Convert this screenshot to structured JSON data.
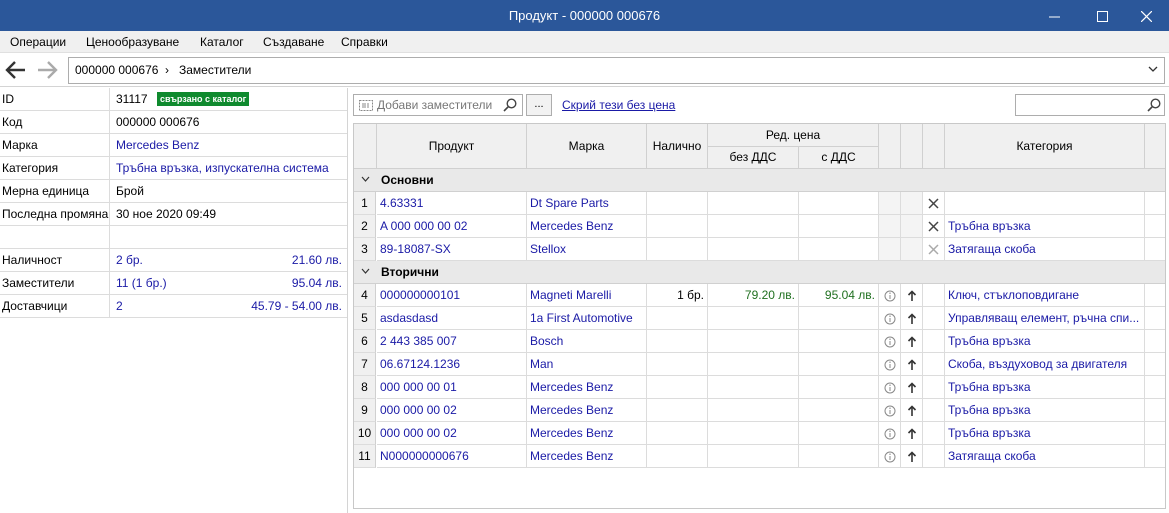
{
  "window": {
    "title": "Продукт - 000000 000676"
  },
  "menu": [
    "Операции",
    "Ценообразуване",
    "Каталог",
    "Създаване",
    "Справки"
  ],
  "breadcrumb": {
    "product": "000000 000676",
    "section": "Заместители"
  },
  "props": {
    "id": {
      "label": "ID",
      "value": "31117",
      "badge": "свързано с каталог"
    },
    "code": {
      "label": "Код",
      "value": "000000 000676"
    },
    "brand": {
      "label": "Марка",
      "value": "Mercedes Benz"
    },
    "category": {
      "label": "Категория",
      "value": "Тръбна връзка, изпускателна система"
    },
    "unit": {
      "label": "Мерна единица",
      "value": "Брой"
    },
    "modified": {
      "label": "Последна промяна",
      "value": "30 ное 2020 09:49"
    },
    "stock": {
      "label": "Наличност",
      "value": "2 бр.",
      "right": "21.60 лв."
    },
    "substitutes": {
      "label": "Заместители",
      "value": "11 (1 бр.)",
      "right": "95.04 лв."
    },
    "suppliers": {
      "label": "Доставчици",
      "value": "2",
      "right": "45.79 - 54.00 лв."
    }
  },
  "toolbar": {
    "add_placeholder": "Добави заместители",
    "dots": "...",
    "hide_link": "Скрий тези без цена"
  },
  "grid": {
    "headers": {
      "product": "Продукт",
      "brand": "Марка",
      "stock": "Налично",
      "price_group": "Ред. цена",
      "no_vat": "без ДДС",
      "with_vat": "с ДДС",
      "category": "Категория"
    },
    "groups": {
      "primary": "Основни",
      "secondary": "Вторични"
    },
    "rows": [
      {
        "n": "1",
        "product": "4.63331",
        "brand": "Dt Spare Parts",
        "stock": "",
        "no_vat": "",
        "with_vat": "",
        "category": ""
      },
      {
        "n": "2",
        "product": "A 000 000 00 02",
        "brand": "Mercedes Benz",
        "stock": "",
        "no_vat": "",
        "with_vat": "",
        "category": "Тръбна връзка"
      },
      {
        "n": "3",
        "product": "89-18087-SX",
        "brand": "Stellox",
        "stock": "",
        "no_vat": "",
        "with_vat": "",
        "category": "Затягаща скоба"
      },
      {
        "n": "4",
        "product": "000000000101",
        "brand": "Magneti Marelli",
        "stock": "1 бр.",
        "no_vat": "79.20 лв.",
        "with_vat": "95.04 лв.",
        "category": "Ключ, стъклоповдигане"
      },
      {
        "n": "5",
        "product": "asdasdasd",
        "brand": "1a First Automotive",
        "stock": "",
        "no_vat": "",
        "with_vat": "",
        "category": "Управляващ елемент, ръчна спи..."
      },
      {
        "n": "6",
        "product": "2 443 385 007",
        "brand": "Bosch",
        "stock": "",
        "no_vat": "",
        "with_vat": "",
        "category": "Тръбна връзка"
      },
      {
        "n": "7",
        "product": "06.67124.1236",
        "brand": "Man",
        "stock": "",
        "no_vat": "",
        "with_vat": "",
        "category": "Скоба, въздуховод за двигателя"
      },
      {
        "n": "8",
        "product": "000 000 00 01",
        "brand": "Mercedes Benz",
        "stock": "",
        "no_vat": "",
        "with_vat": "",
        "category": "Тръбна връзка"
      },
      {
        "n": "9",
        "product": "000 000 00 02",
        "brand": "Mercedes Benz",
        "stock": "",
        "no_vat": "",
        "with_vat": "",
        "category": "Тръбна връзка"
      },
      {
        "n": "10",
        "product": "000 000 00 02",
        "brand": "Mercedes Benz",
        "stock": "",
        "no_vat": "",
        "with_vat": "",
        "category": "Тръбна връзка"
      },
      {
        "n": "11",
        "product": "N000000000676",
        "brand": "Mercedes Benz",
        "stock": "",
        "no_vat": "",
        "with_vat": "",
        "category": "Затягаща скоба"
      }
    ]
  },
  "colors": {
    "titlebar": "#2b579a",
    "link": "#1a1aa6",
    "badge": "#0f8a2e",
    "price": "#207020"
  },
  "icons": {
    "back": "arrow-left-icon",
    "forward": "arrow-right-icon",
    "remove": "close-icon",
    "info": "info-icon",
    "promote": "arrow-up-icon",
    "search": "search-icon",
    "barcode": "barcode-icon"
  }
}
